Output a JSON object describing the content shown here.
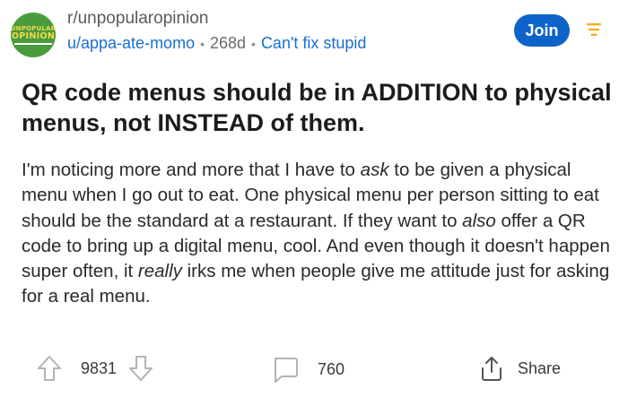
{
  "post": {
    "subreddit": "r/unpopularopinion",
    "subreddit_avatar": {
      "line1": "UNPOPULAR",
      "line2": "OPINION",
      "bg": "#4a9b3b",
      "fg": "#f2d94b"
    },
    "author": "u/appa-ate-momo",
    "age": "268d",
    "flair": "Can't fix stupid",
    "title": "QR code menus should be in ADDITION to physical menus, not INSTEAD of them.",
    "body_parts": [
      "I'm noticing more and more that I have to ",
      "ask",
      " to be given a physical menu when I go out to eat. One physical menu per person sitting to eat should be the standard at a restaurant. If they want to ",
      "also",
      " offer a QR code to bring up a digital menu, cool. And even though it doesn't happen super often, it ",
      "really",
      " irks me when people give me attitude just for asking for a real menu."
    ]
  },
  "header": {
    "join_label": "Join",
    "menu_icon": "sort-lines-icon"
  },
  "actions": {
    "upvote_icon": "arrow-up-icon",
    "score": "9831",
    "downvote_icon": "arrow-down-icon",
    "comment_icon": "comment-bubble-icon",
    "comments": "760",
    "share_icon": "share-icon",
    "share_label": "Share"
  },
  "colors": {
    "link": "#1a6ecf",
    "join_bg": "#0d63c9",
    "menu_icon": "#f0b21c",
    "icon_gray": "#aaaaaa"
  }
}
